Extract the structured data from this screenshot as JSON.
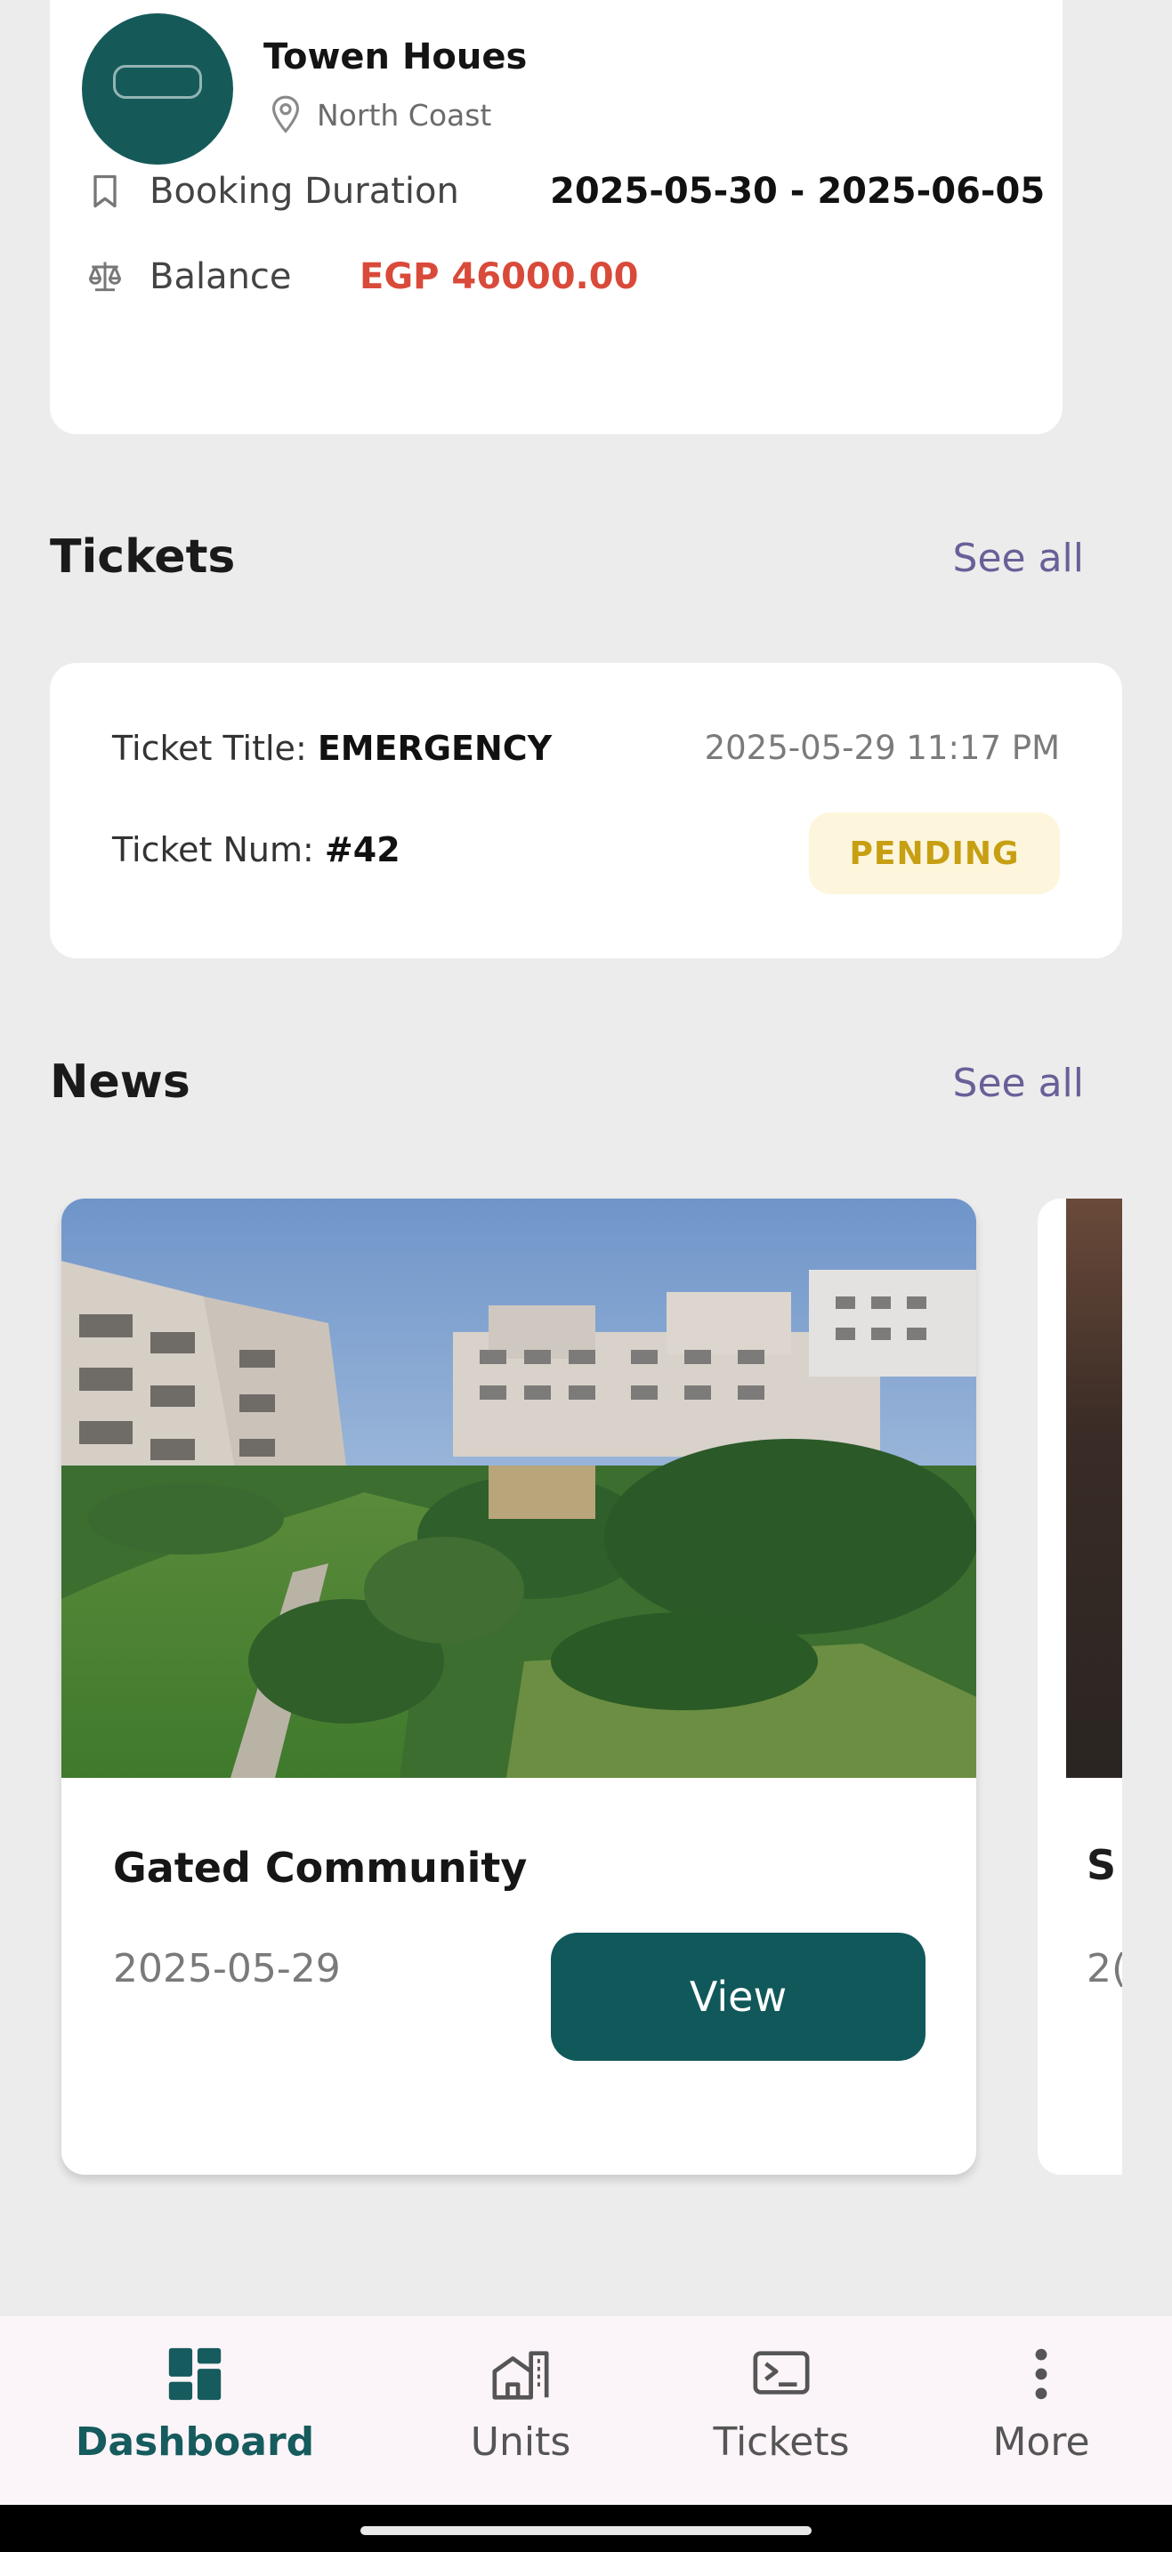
{
  "booking": {
    "property_name": "Towen Houes",
    "location": "North Coast",
    "duration_label": "Booking Duration",
    "duration_value": "2025-05-30 - 2025-06-05",
    "balance_label": "Balance",
    "balance_value": "EGP 46000.00",
    "balance_color": "#d94a3a",
    "icons": [
      "location-pin-icon",
      "bookmark-icon",
      "scale-icon"
    ]
  },
  "tickets_section": {
    "title": "Tickets",
    "see_all": "See all",
    "ticket": {
      "title_label": "Ticket Title: ",
      "title_value": "EMERGENCY",
      "date": "2025-05-29 11:17 PM",
      "num_label": "Ticket Num: ",
      "num_value": "#42",
      "status": "PENDING",
      "status_color": "#c79f12"
    }
  },
  "news_section": {
    "title": "News",
    "see_all": "See all",
    "items": [
      {
        "title": "Gated Community",
        "date": "2025-05-29",
        "button": "View"
      },
      {
        "title": "S",
        "date": "2("
      }
    ]
  },
  "bottom_nav": {
    "items": [
      {
        "label": "Dashboard",
        "icon": "dashboard-icon",
        "active": true
      },
      {
        "label": "Units",
        "icon": "building-icon",
        "active": false
      },
      {
        "label": "Tickets",
        "icon": "ticket-icon",
        "active": false
      },
      {
        "label": "More",
        "icon": "more-vertical-icon",
        "active": false
      }
    ]
  },
  "colors": {
    "brand": "#155a59",
    "accent_link": "#6a5f98",
    "background": "#ececec"
  }
}
